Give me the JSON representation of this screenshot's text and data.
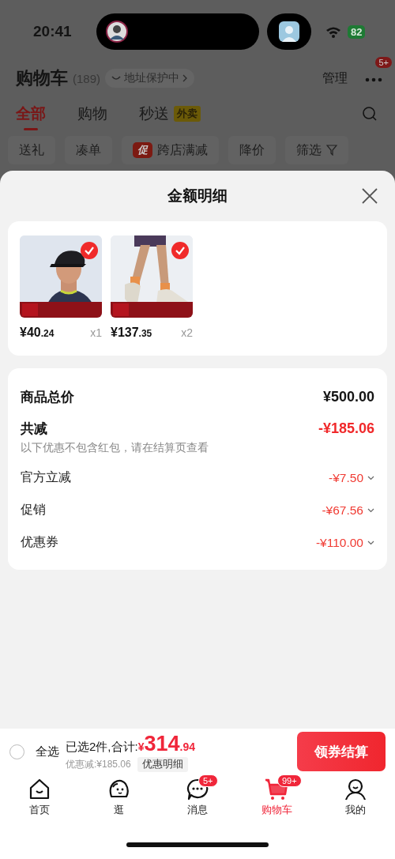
{
  "status_bar": {
    "time": "20:41",
    "battery": "82"
  },
  "header": {
    "title": "购物车",
    "count": "(189)",
    "address_protection": "地址保护中",
    "manage": "管理",
    "more_badge": "5+"
  },
  "tabs": [
    {
      "label": "全部",
      "selected": true
    },
    {
      "label": "购物",
      "selected": false
    },
    {
      "label": "秒送",
      "selected": false,
      "tag": "外卖"
    }
  ],
  "chips": [
    {
      "label": "送礼"
    },
    {
      "label": "凑单"
    },
    {
      "label": "跨店满减",
      "icon_text": "促"
    },
    {
      "label": "降价"
    },
    {
      "label": "筛选",
      "kind": "filter"
    }
  ],
  "sheet": {
    "title": "金额明细",
    "items": [
      {
        "kind": "cap",
        "selected": true,
        "price": "¥40",
        "price_decimal": ".24",
        "quantity": "x1"
      },
      {
        "kind": "shoes",
        "selected": true,
        "price": "¥137",
        "price_decimal": ".35",
        "quantity": "x2"
      }
    ],
    "total": {
      "label": "商品总价",
      "value": "¥500.00"
    },
    "discount": {
      "label": "共减",
      "value": "-¥185.06",
      "note": "以下优惠不包含红包，请在结算页查看"
    },
    "details": [
      {
        "label": "官方立减",
        "value": "-¥7.50",
        "expanded": false
      },
      {
        "label": "促销",
        "value": "-¥67.56",
        "expanded": false
      },
      {
        "label": "优惠券",
        "value": "-¥110.00",
        "expanded": false
      }
    ]
  },
  "bottom_bar": {
    "select_all": {
      "label": "全选",
      "checked": false
    },
    "summary": "已选2件,合计:",
    "currency": "¥",
    "total": "314",
    "total_decimal": ".94",
    "saved": "优惠减:¥185.06",
    "detail_button": "优惠明细",
    "checkout": "领券结算"
  },
  "nav": [
    {
      "label": "首页",
      "kind": "home",
      "selected": false
    },
    {
      "label": "逛",
      "kind": "explore",
      "selected": false
    },
    {
      "label": "消息",
      "kind": "message",
      "selected": false,
      "badge": "5+"
    },
    {
      "label": "购物车",
      "kind": "cart",
      "selected": true,
      "badge": "99+"
    },
    {
      "label": "我的",
      "kind": "profile",
      "selected": false
    }
  ]
}
